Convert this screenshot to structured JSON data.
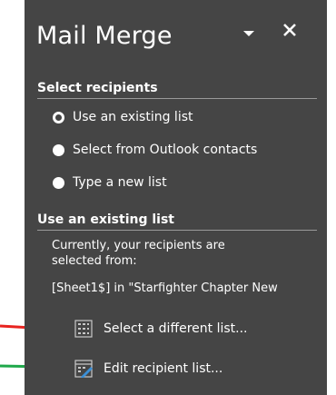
{
  "pane": {
    "title": "Mail Merge",
    "menu_icon": "dropdown-triangle-icon",
    "close_icon": "close-x-icon",
    "background": "#454545"
  },
  "select_recipients": {
    "heading": "Select recipients",
    "options": [
      {
        "label": "Use an existing list",
        "checked": true
      },
      {
        "label": "Select from Outlook contacts",
        "checked": false
      },
      {
        "label": "Type a new list",
        "checked": false
      }
    ]
  },
  "existing_list": {
    "heading": "Use an existing list",
    "description_line1": "Currently, your recipients are",
    "description_line2": "selected from:",
    "source": "[Sheet1$] in \"Starfighter Chapter New",
    "select_link": "Select a different list...",
    "edit_link": "Edit recipient list...",
    "select_icon": "table-list-icon",
    "edit_icon": "edit-list-icon"
  },
  "annotations": {
    "red_arrow_color": "#e8231f",
    "green_arrow_color": "#1fa84a"
  }
}
